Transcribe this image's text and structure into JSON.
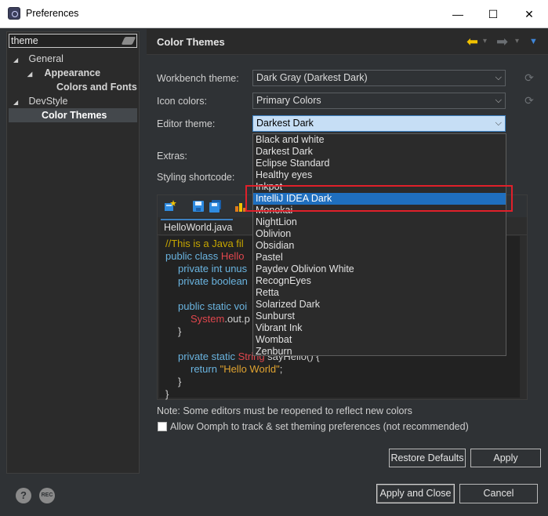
{
  "window": {
    "title": "Preferences",
    "minimize_glyph": "—",
    "maximize_glyph": "☐",
    "close_glyph": "✕"
  },
  "left": {
    "filter_value": "theme",
    "tree": [
      {
        "label": "General",
        "expanded": true
      },
      {
        "label": "Appearance",
        "expanded": true
      },
      {
        "label": "Colors and Fonts"
      },
      {
        "label": "DevStyle",
        "expanded": true
      },
      {
        "label": "Color Themes",
        "selected": true
      }
    ],
    "expanded_glyph": "◢"
  },
  "header": {
    "title": "Color Themes",
    "back_glyph": "⬅",
    "forward_glyph": "➡",
    "menu_glyph": "▼",
    "small_caret_glyph": "▾"
  },
  "form": {
    "workbench_label": "Workbench theme:",
    "workbench_value": "Dark Gray (Darkest Dark)",
    "icon_colors_label": "Icon colors:",
    "icon_colors_value": "Primary Colors",
    "editor_theme_label": "Editor theme:",
    "editor_theme_value": "Darkest Dark",
    "extras_label": "Extras:",
    "styling_label": "Styling shortcode:",
    "caret_glyph": "⌵",
    "reset_glyph": "⟳"
  },
  "dropdown": {
    "options": [
      "Black and white",
      "Darkest Dark",
      "Eclipse Standard",
      "Healthy eyes",
      "Inkpot",
      "IntelliJ IDEA Dark",
      "Monokai",
      "NightLion",
      "Oblivion",
      "Obsidian",
      "Pastel",
      "Paydev Oblivion White",
      "RecognEyes",
      "Retta",
      "Solarized Dark",
      "Sunburst",
      "Vibrant Ink",
      "Wombat",
      "Zenburn"
    ],
    "selected": "IntelliJ IDEA Dark"
  },
  "preview": {
    "tab": "HelloWorld.java",
    "code": {
      "l1": "//This is a Java fil",
      "l2_kw": "public class ",
      "l2_type": "Hello",
      "l3_kw": "private int unus",
      "l4_kw": "private boolean",
      "l5_kw": "public static voi",
      "l6_type": "System",
      "l6_plain": ".out.p",
      "l7": "}",
      "l8_kw": "private static ",
      "l8_type": "String",
      "l8_plain": " sayHello() {",
      "l9_kw": "return ",
      "l9_str": "\"Hello World\"",
      "l9_plain": ";",
      "l10": "}",
      "l11": "}"
    }
  },
  "notes": {
    "reopen": "Note: Some editors must be reopened to reflect new colors",
    "oomph": "Allow Oomph to track & set theming preferences (not recommended)"
  },
  "buttons": {
    "restore_defaults": "Restore Defaults",
    "apply": "Apply",
    "apply_and_close": "Apply and Close",
    "cancel": "Cancel"
  },
  "footer": {
    "help_glyph": "?",
    "rec_label": "REC"
  },
  "colors": {
    "accent": "#1f6fbf",
    "highlight_box": "#e0202a",
    "back_arrow": "#f2c200"
  }
}
